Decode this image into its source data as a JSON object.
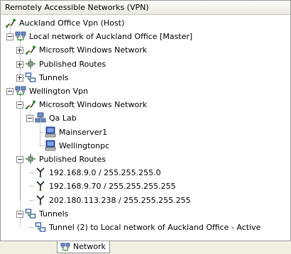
{
  "panel": {
    "header": "Remotely Accessible Networks (VPN)"
  },
  "tree": [
    {
      "label": "Auckland Office Vpn (Host)",
      "icon": "vpn-connection-icon"
    },
    {
      "label": "Local network of Auckland Office [Master]",
      "icon": "network-computers-icon",
      "expander": "collapse"
    },
    {
      "label": "Microsoft Windows Network",
      "icon": "vpn-connection-icon",
      "expander": "expand"
    },
    {
      "label": "Published Routes",
      "icon": "route-hub-icon",
      "expander": "expand"
    },
    {
      "label": "Tunnels",
      "icon": "tunnels-icon",
      "expander": "expand"
    },
    {
      "label": "Wellington Vpn",
      "icon": "network-computers-icon",
      "expander": "collapse"
    },
    {
      "label": "Microsoft Windows Network",
      "icon": "vpn-connection-icon",
      "expander": "collapse"
    },
    {
      "label": "Qa Lab",
      "icon": "workgroup-icon",
      "expander": "collapse"
    },
    {
      "label": "Mainserver1",
      "icon": "computer-icon"
    },
    {
      "label": "Wellingtonpc",
      "icon": "computer-icon"
    },
    {
      "label": "Published Routes",
      "icon": "route-hub-icon",
      "expander": "collapse"
    },
    {
      "label": "192.168.9.0 / 255.255.255.0",
      "icon": "route-icon"
    },
    {
      "label": "192.168.9.70 / 255.255.255.255",
      "icon": "route-icon"
    },
    {
      "label": "202.180.113.238 / 255.255.255.255",
      "icon": "route-icon"
    },
    {
      "label": "Tunnels",
      "icon": "tunnels-icon",
      "expander": "collapse"
    },
    {
      "label": "Tunnel (2) to Local network of Auckland Office - Active",
      "icon": "tunnels-icon"
    }
  ],
  "tabs": [
    {
      "label": "Network",
      "icon": "network-computers-icon"
    }
  ],
  "colors": {
    "panel_border": "#9a9a9a",
    "tree_line": "#9a9a9a",
    "tab_strip": "#f1efe2",
    "icon_green": "#2e8b2e",
    "icon_blue": "#1f4fb0"
  }
}
